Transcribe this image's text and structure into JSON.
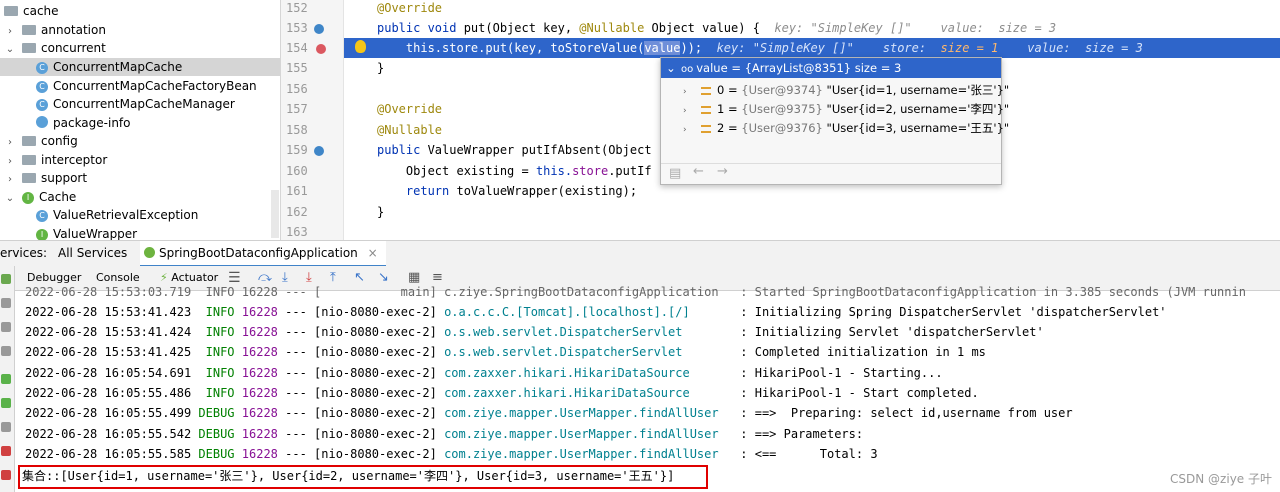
{
  "tree": {
    "items": [
      {
        "label": "cache",
        "icon": "folder-icon",
        "chevron": ""
      },
      {
        "label": "annotation",
        "icon": "folder-icon",
        "chevron": ">"
      },
      {
        "label": "concurrent",
        "icon": "folder-icon",
        "chevron": "v"
      },
      {
        "label": "ConcurrentMapCache",
        "icon": "class-icon",
        "chevron": ""
      },
      {
        "label": "ConcurrentMapCacheFactoryBean",
        "icon": "class-icon",
        "chevron": ""
      },
      {
        "label": "ConcurrentMapCacheManager",
        "icon": "class-icon",
        "chevron": ""
      },
      {
        "label": "package-info",
        "icon": "package-info-icon",
        "chevron": ""
      },
      {
        "label": "config",
        "icon": "folder-icon",
        "chevron": ">"
      },
      {
        "label": "interceptor",
        "icon": "folder-icon",
        "chevron": ">"
      },
      {
        "label": "support",
        "icon": "folder-icon",
        "chevron": ">"
      },
      {
        "label": "Cache",
        "icon": "interface-icon",
        "chevron": "v"
      },
      {
        "label": "ValueRetrievalException",
        "icon": "class-icon",
        "chevron": ""
      },
      {
        "label": "ValueWrapper",
        "icon": "interface-icon",
        "chevron": ""
      }
    ]
  },
  "editor": {
    "line_numbers": [
      "152",
      "153",
      "154",
      "155",
      "156",
      "157",
      "158",
      "159",
      "160",
      "161",
      "162",
      "163"
    ],
    "lines": {
      "l152": "@Override",
      "l153_kw": "public void ",
      "l153_rest": "put(Object key, ",
      "l153_an": "@Nullable ",
      "l153_rest2": "Object value) {  ",
      "l153_hint": "key: \"SimpleKey []\"    value:  size = 3",
      "l154_a": "    this.",
      "l154_fld": "store",
      "l154_b": ".put(key, toStoreValue(",
      "l154_sel": "value",
      "l154_c": "));  ",
      "l154_hint1": "key: \"SimpleKey []\"    store: ",
      "l154_hint2": " size = 1",
      "l154_hint3": "    value:  size = 3",
      "l155": "}",
      "l157": "@Override",
      "l158": "@Nullable",
      "l159_kw": "public ",
      "l159_rest": "ValueWrapper putIfAbsent(Object",
      "l160_a": "    Object existing = ",
      "l160_kw": "this.",
      "l160_fld": "store",
      "l160_b": ".putIf",
      "l161_kw": "    return ",
      "l161_rest": "toValueWrapper(existing);",
      "l162": "}"
    }
  },
  "popup": {
    "header": "value = {ArrayList@8351}  size = 3",
    "rows": [
      {
        "index": "0 = ",
        "ref": "{User@9374} ",
        "value": "\"User{id=1, username='张三'}\""
      },
      {
        "index": "1 = ",
        "ref": "{User@9375} ",
        "value": "\"User{id=2, username='李四'}\""
      },
      {
        "index": "2 = ",
        "ref": "{User@9376} ",
        "value": "\"User{id=3, username='王五'}\""
      }
    ]
  },
  "services": {
    "label": "ervices:",
    "all": "All Services",
    "tab": "SpringBootDataconfigApplication",
    "close": "×"
  },
  "debug_toolbar": {
    "debugger": "Debugger",
    "console": "Console",
    "actuator": "Actuator"
  },
  "console": {
    "top_partial": "2022-06-28 15:53:03.719  INFO 16228 --- [           main] c.ziye.SpringBootDataconfigApplication   : Started SpringBootDataconfigApplication in 3.385 seconds (JVM runnin",
    "logs": [
      {
        "ts": "2022-06-28 15:53:41.423",
        "lvl": " INFO",
        "pid": "16228",
        "thread": " --- [nio-8080-exec-2] ",
        "logger": "o.a.c.c.C.[Tomcat].[localhost].[/]      ",
        "msg": " : Initializing Spring DispatcherServlet 'dispatcherServlet'"
      },
      {
        "ts": "2022-06-28 15:53:41.424",
        "lvl": " INFO",
        "pid": "16228",
        "thread": " --- [nio-8080-exec-2] ",
        "logger": "o.s.web.servlet.DispatcherServlet       ",
        "msg": " : Initializing Servlet 'dispatcherServlet'"
      },
      {
        "ts": "2022-06-28 15:53:41.425",
        "lvl": " INFO",
        "pid": "16228",
        "thread": " --- [nio-8080-exec-2] ",
        "logger": "o.s.web.servlet.DispatcherServlet       ",
        "msg": " : Completed initialization in 1 ms"
      },
      {
        "ts": "2022-06-28 16:05:54.691",
        "lvl": " INFO",
        "pid": "16228",
        "thread": " --- [nio-8080-exec-2] ",
        "logger": "com.zaxxer.hikari.HikariDataSource      ",
        "msg": " : HikariPool-1 - Starting..."
      },
      {
        "ts": "2022-06-28 16:05:55.486",
        "lvl": " INFO",
        "pid": "16228",
        "thread": " --- [nio-8080-exec-2] ",
        "logger": "com.zaxxer.hikari.HikariDataSource      ",
        "msg": " : HikariPool-1 - Start completed."
      },
      {
        "ts": "2022-06-28 16:05:55.499",
        "lvl": "DEBUG",
        "pid": "16228",
        "thread": " --- [nio-8080-exec-2] ",
        "logger": "com.ziye.mapper.UserMapper.findAllUser  ",
        "msg": " : ==>  Preparing: select id,username from user"
      },
      {
        "ts": "2022-06-28 16:05:55.542",
        "lvl": "DEBUG",
        "pid": "16228",
        "thread": " --- [nio-8080-exec-2] ",
        "logger": "com.ziye.mapper.UserMapper.findAllUser  ",
        "msg": " : ==> Parameters: "
      },
      {
        "ts": "2022-06-28 16:05:55.585",
        "lvl": "DEBUG",
        "pid": "16228",
        "thread": " --- [nio-8080-exec-2] ",
        "logger": "com.ziye.mapper.UserMapper.findAllUser  ",
        "msg": " : <==      Total: 3"
      }
    ],
    "result": "集合::[User{id=1, username='张三'}, User{id=2, username='李四'}, User{id=3, username='王五'}]"
  },
  "watermark": "CSDN @ziye 子叶"
}
